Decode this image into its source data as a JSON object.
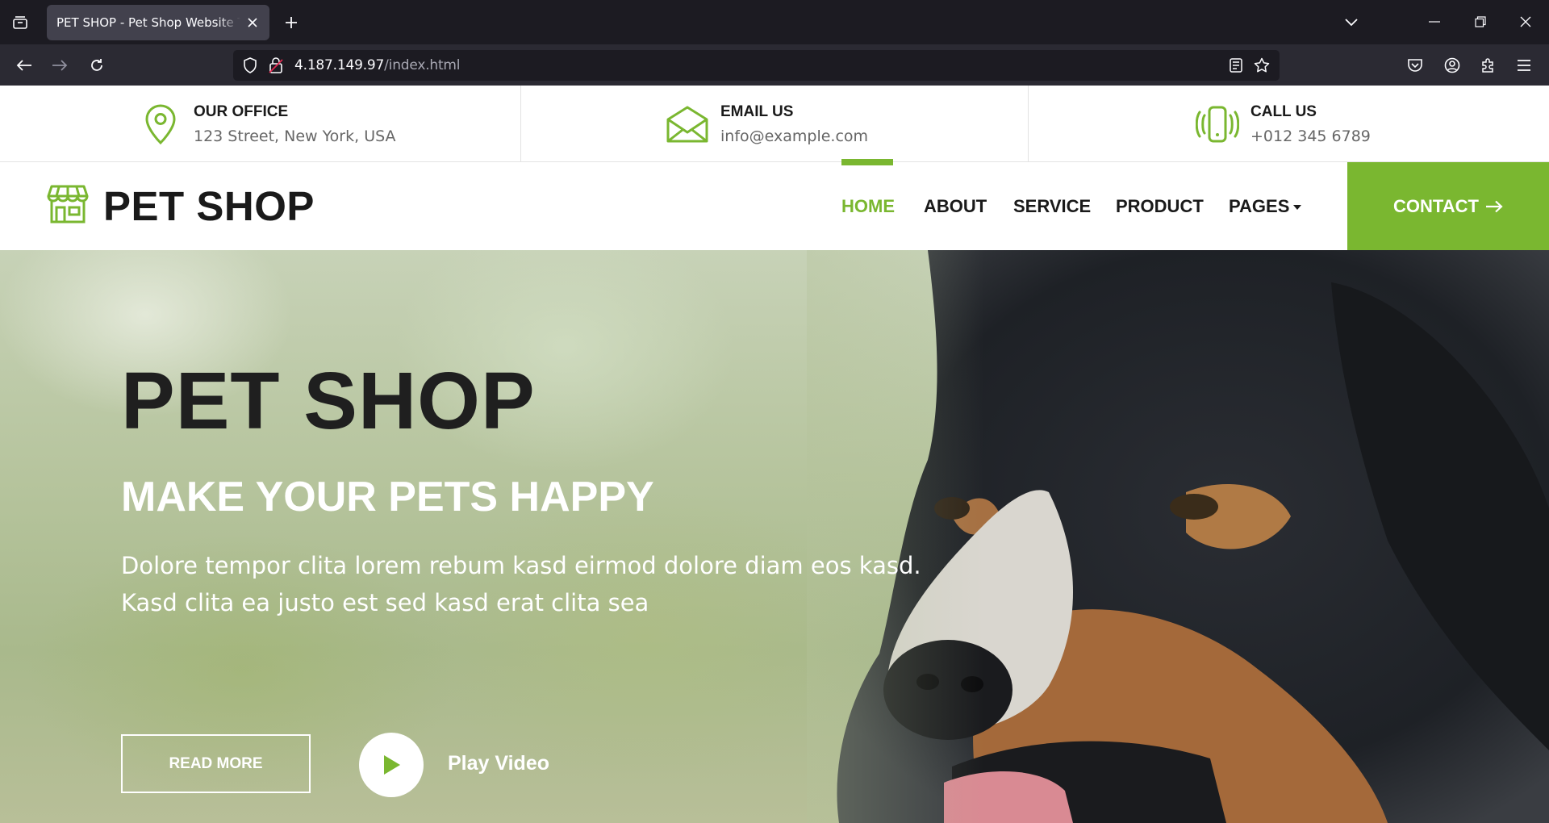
{
  "browser": {
    "tab_title": "PET SHOP - Pet Shop Website Template",
    "url_host": "4.187.149.97",
    "url_path": "/index.html"
  },
  "topbar": {
    "office": {
      "label": "OUR OFFICE",
      "value": "123 Street, New York, USA",
      "icon": "map-pin-icon"
    },
    "email": {
      "label": "EMAIL US",
      "value": "info@example.com",
      "icon": "envelope-icon"
    },
    "call": {
      "label": "CALL US",
      "value": "+012 345 6789",
      "icon": "phone-vibrate-icon"
    }
  },
  "nav": {
    "brand": "PET SHOP",
    "brand_icon": "shop-icon",
    "items": [
      {
        "label": "HOME",
        "active": true
      },
      {
        "label": "ABOUT"
      },
      {
        "label": "SERVICE"
      },
      {
        "label": "PRODUCT"
      },
      {
        "label": "PAGES",
        "dropdown": true
      }
    ],
    "contact_label": "CONTACT"
  },
  "hero": {
    "title": "PET SHOP",
    "subtitle": "MAKE YOUR PETS HAPPY",
    "text_line1": "Dolore tempor clita lorem rebum kasd eirmod dolore diam eos kasd.",
    "text_line2": "Kasd clita ea justo est sed kasd erat clita sea",
    "read_more": "READ MORE",
    "play_video": "Play Video"
  },
  "colors": {
    "accent": "#7ab730",
    "dark": "#1a1a1a",
    "chrome_dark": "#1c1b22",
    "chrome_mid": "#2b2a33"
  }
}
